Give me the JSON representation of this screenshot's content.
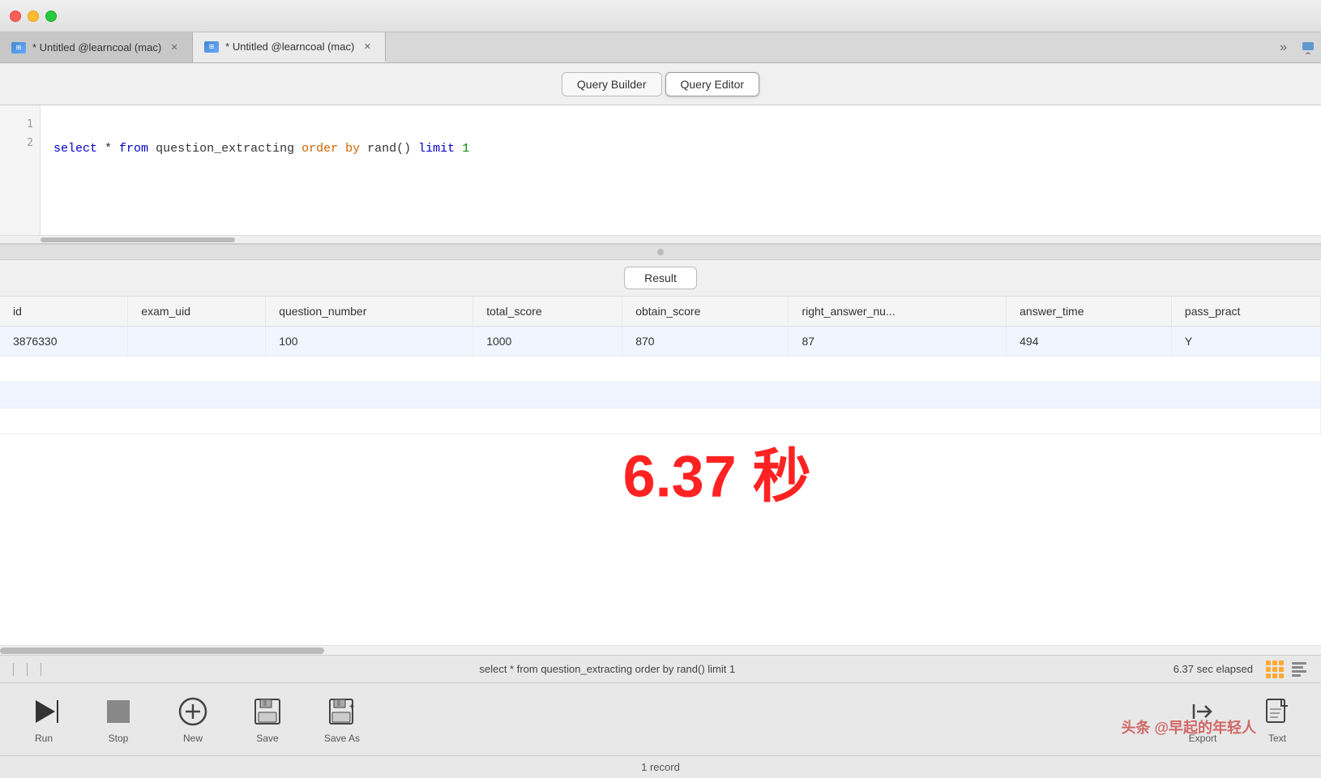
{
  "titlebar": {
    "traffic_lights": [
      "red",
      "yellow",
      "green"
    ]
  },
  "tabs": [
    {
      "label": "* Untitled @learncoal (mac)",
      "active": false
    },
    {
      "label": "* Untitled @learncoal (mac)",
      "active": true
    }
  ],
  "toolbar": {
    "query_builder_label": "Query Builder",
    "query_editor_label": "Query Editor"
  },
  "editor": {
    "line_numbers": [
      "1",
      "2"
    ],
    "code_line2": "select * from question_extracting order by rand() limit 1"
  },
  "result": {
    "tab_label": "Result",
    "columns": [
      "id",
      "exam_uid",
      "question_number",
      "total_score",
      "obtain_score",
      "right_answer_nu...",
      "answer_time",
      "pass_pract"
    ],
    "row": [
      "3876330",
      "",
      "100",
      "1000",
      "870",
      "87",
      "494",
      "Y"
    ],
    "overlay_time": "6.37 秒"
  },
  "status_bar": {
    "query": "select * from question_extracting order by rand() limit 1",
    "elapsed": "6.37 sec elapsed",
    "record_count": "1 record"
  },
  "bottom_toolbar": {
    "run_label": "Run",
    "stop_label": "Stop",
    "new_label": "New",
    "save_label": "Save",
    "save_as_label": "Save As",
    "export_label": "Export",
    "text_label": "Text"
  },
  "watermark": "头条 @早起的年轻人"
}
